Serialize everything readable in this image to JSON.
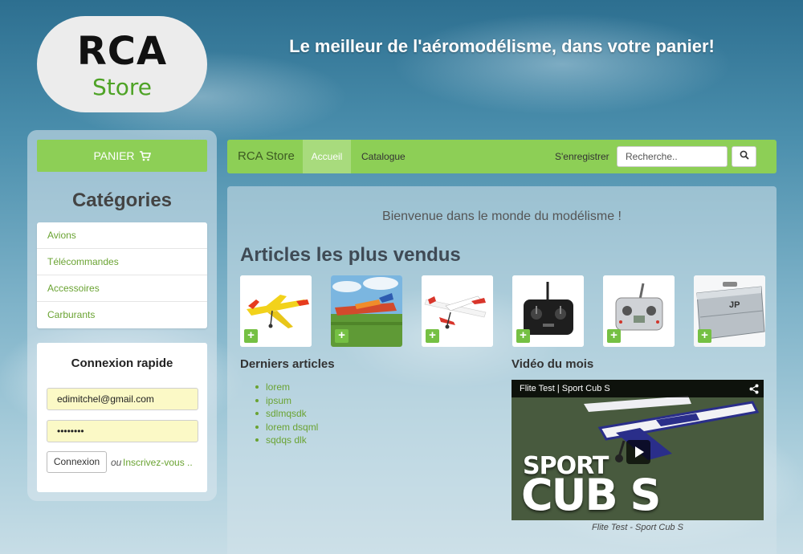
{
  "logo": {
    "line1": "RCA",
    "line2": "Store"
  },
  "tagline": "Le meilleur de l'aéromodélisme, dans votre panier!",
  "sidebar": {
    "cart_label": "PANIER",
    "categories_title": "Catégories",
    "categories": [
      "Avions",
      "Télécommandes",
      "Accessoires",
      "Carburants"
    ],
    "login": {
      "title": "Connexion rapide",
      "email_value": "edimitchel@gmail.com",
      "password_value": "••••••••",
      "submit_label": "Connexion",
      "or_text": "ou",
      "register_link": "Inscrivez-vous .."
    }
  },
  "navbar": {
    "brand": "RCA Store",
    "home": "Accueil",
    "catalog": "Catalogue",
    "register": "S'enregistrer",
    "search_placeholder": "Recherche.."
  },
  "main": {
    "welcome": "Bienvenue dans le monde du modélisme !",
    "best_sellers_title": "Articles les plus vendus",
    "products": [
      {
        "name": "yellow aerobatic plane"
      },
      {
        "name": "plane on grass field"
      },
      {
        "name": "white red trainer plane"
      },
      {
        "name": "black radio transmitter"
      },
      {
        "name": "silver radio transmitter"
      },
      {
        "name": "aluminium transmitter case",
        "case_label": "JP"
      }
    ],
    "add_symbol": "+",
    "latest_title": "Derniers articles",
    "latest_items": [
      "lorem",
      "ipsum",
      "sdlmqsdk",
      "lorem dsqml",
      "sqdqs dlk"
    ],
    "video_title": "Vidéo du mois",
    "video": {
      "bar_title": "Flite Test | Sport Cub S",
      "overlay_line1": "SPORT",
      "overlay_line2": "CUB S",
      "caption": "Flite Test - Sport Cub S"
    }
  },
  "colors": {
    "accent_green": "#8dcf56",
    "link_green": "#6aa332",
    "plus_green": "#75c043"
  }
}
